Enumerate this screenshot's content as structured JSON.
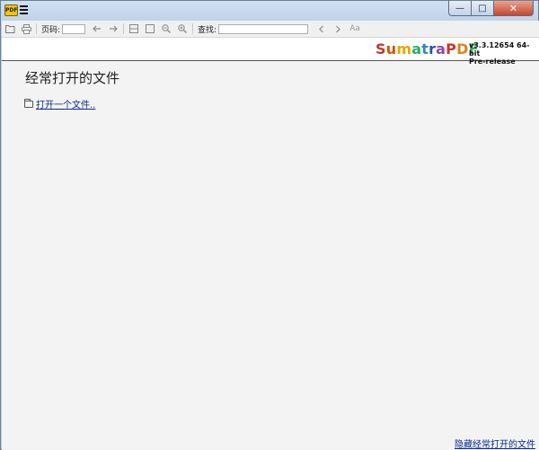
{
  "titlebar": {
    "app_icon_text": "PDF",
    "icons": {
      "app": "sumatra-app-icon",
      "menu": "hamburger-menu-icon"
    },
    "buttons": {
      "minimize": "—",
      "maximize": "□",
      "close": "✕"
    }
  },
  "toolbar": {
    "page_label": "页码:",
    "page_value": "",
    "find_label": "查找:",
    "find_value": "",
    "match_case_label": "Aa",
    "icons": {
      "open": "folder-open-icon",
      "print": "print-icon",
      "prev_page": "arrow-left-icon",
      "next_page": "arrow-right-icon",
      "fit_page": "fit-page-icon",
      "fit_width": "fit-width-icon",
      "zoom_out": "zoom-out-icon",
      "zoom_in": "zoom-in-icon",
      "find_prev": "chevron-left-icon",
      "find_next": "chevron-right-icon"
    }
  },
  "logo": {
    "letters": [
      {
        "ch": "S",
        "color": "#c0392b"
      },
      {
        "ch": "u",
        "color": "#d35400"
      },
      {
        "ch": "m",
        "color": "#e0a800"
      },
      {
        "ch": "a",
        "color": "#27ae60"
      },
      {
        "ch": "t",
        "color": "#2e86c1"
      },
      {
        "ch": "r",
        "color": "#2e4fa3"
      },
      {
        "ch": "a",
        "color": "#8e44ad"
      },
      {
        "ch": "P",
        "color": "#c0392b"
      },
      {
        "ch": "D",
        "color": "#e67e22"
      },
      {
        "ch": "F",
        "color": "#27ae60"
      }
    ],
    "version_line1": "v3.3.12654 64-bit",
    "version_line2": "Pre-release"
  },
  "main": {
    "section_title": "经常打开的文件",
    "open_file_link": "打开一个文件..",
    "hide_recent_link": "隐藏经常打开的文件"
  },
  "colors": {
    "link": "#0b2a8c",
    "background": "#f3f3f3",
    "close_button": "#c7462c"
  }
}
